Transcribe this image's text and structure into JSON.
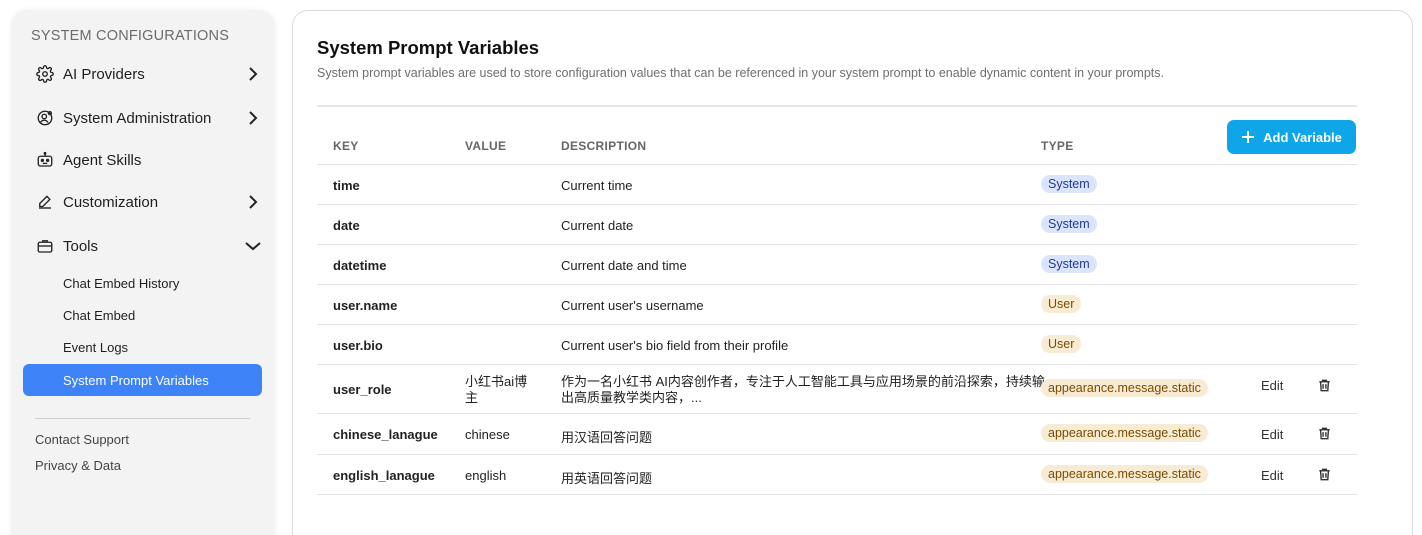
{
  "sidebar": {
    "title": "SYSTEM CONFIGURATIONS",
    "items": [
      {
        "label": "AI Providers",
        "icon": "gear-icon"
      },
      {
        "label": "System Administration",
        "icon": "user-gear-icon"
      },
      {
        "label": "Agent Skills",
        "icon": "robot-icon"
      },
      {
        "label": "Customization",
        "icon": "pencil-icon"
      },
      {
        "label": "Tools",
        "icon": "briefcase-icon"
      }
    ],
    "tools_sub": [
      "Chat Embed History",
      "Chat Embed",
      "Event Logs",
      "System Prompt Variables"
    ],
    "footer": [
      "Contact Support",
      "Privacy & Data"
    ]
  },
  "main": {
    "title": "System Prompt Variables",
    "description": "System prompt variables are used to store configuration values that can be referenced in your system prompt to enable dynamic content in your prompts.",
    "add_button": "Add Variable",
    "columns": [
      "KEY",
      "VALUE",
      "DESCRIPTION",
      "TYPE"
    ],
    "edit_label": "Edit",
    "rows": [
      {
        "key": "time",
        "value": "",
        "description": "Current time",
        "type": "System"
      },
      {
        "key": "date",
        "value": "",
        "description": "Current date",
        "type": "System"
      },
      {
        "key": "datetime",
        "value": "",
        "description": "Current date and time",
        "type": "System"
      },
      {
        "key": "user.name",
        "value": "",
        "description": "Current user's username",
        "type": "User"
      },
      {
        "key": "user.bio",
        "value": "",
        "description": "Current user's bio field from their profile",
        "type": "User"
      },
      {
        "key": "user_role",
        "value_l1": "小红书ai博",
        "value_l2": "主",
        "desc_l1": "作为一名小红书 AI内容创作者，专注于人工智能工具与应用场景的前沿探索，持续输",
        "desc_l2": "出高质量教学类内容，...",
        "type": "appearance.message.static"
      },
      {
        "key": "chinese_lanague",
        "value": "chinese",
        "description": "用汉语回答问题",
        "type": "appearance.message.static"
      },
      {
        "key": "english_lanague",
        "value": "english",
        "description": "用英语回答问题",
        "type": "appearance.message.static"
      }
    ]
  },
  "colors": {
    "accent": "#3d82f6",
    "button": "#0ea5e9",
    "system_badge": "#dbe4ff",
    "user_badge": "#f7ecd3"
  }
}
